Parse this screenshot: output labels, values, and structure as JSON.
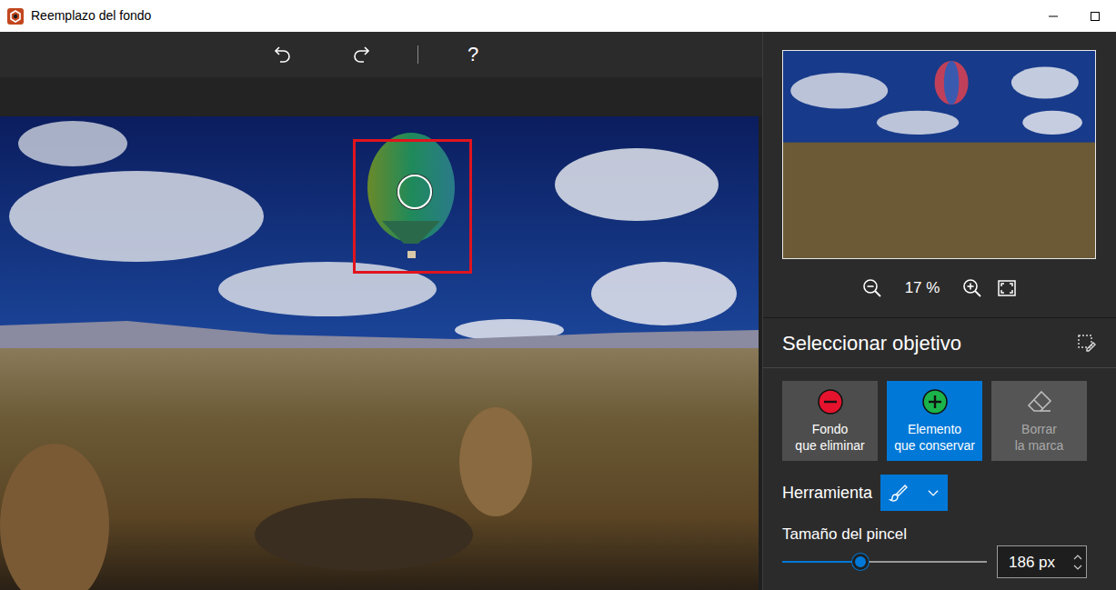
{
  "window": {
    "title": "Reemplazo del fondo"
  },
  "toolbar": {
    "help": "?"
  },
  "zoom": {
    "reading": "17 %"
  },
  "panel": {
    "title": "Seleccionar objetivo"
  },
  "modes": [
    {
      "lines": [
        "Fondo",
        "que eliminar"
      ],
      "kind": "remove",
      "selected": false,
      "disabled": false
    },
    {
      "lines": [
        "Elemento",
        "que conservar"
      ],
      "kind": "keep",
      "selected": true,
      "disabled": false
    },
    {
      "lines": [
        "Borrar",
        "la marca"
      ],
      "kind": "erase",
      "selected": false,
      "disabled": true
    }
  ],
  "tool": {
    "label": "Herramienta"
  },
  "brush": {
    "label": "Tamaño del pincel",
    "level": 0.38,
    "value": "186 px"
  }
}
